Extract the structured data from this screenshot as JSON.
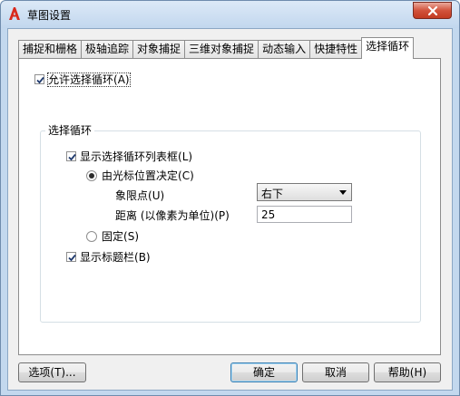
{
  "window": {
    "title": "草图设置"
  },
  "tabs": [
    {
      "label": "捕捉和栅格",
      "active": false
    },
    {
      "label": "极轴追踪",
      "active": false
    },
    {
      "label": "对象捕捉",
      "active": false
    },
    {
      "label": "三维对象捕捉",
      "active": false
    },
    {
      "label": "动态输入",
      "active": false
    },
    {
      "label": "快捷特性",
      "active": false
    },
    {
      "label": "选择循环",
      "active": true
    }
  ],
  "selection_cycling": {
    "allow_label": "允许选择循环",
    "allow_key": "(A)",
    "allow_checked": true,
    "group_title": "选择循环",
    "show_list_label": "显示选择循环列表框",
    "show_list_key": "(L)",
    "show_list_checked": true,
    "cursor_label": "由光标位置决定",
    "cursor_key": "(C)",
    "cursor_selected": true,
    "quadrant_label": "象限点",
    "quadrant_key": "(U)",
    "quadrant_value": "右下",
    "distance_label": "距离 (以像素为单位)",
    "distance_key": "(P)",
    "distance_value": "25",
    "fixed_label": "固定",
    "fixed_key": "(S)",
    "fixed_selected": false,
    "show_title_label": "显示标题栏",
    "show_title_key": "(B)",
    "show_title_checked": true
  },
  "buttons": {
    "options": "选项(T)...",
    "ok": "确定",
    "cancel": "取消",
    "help": "帮助(H)"
  },
  "colors": {
    "accent": "#3c7fb1",
    "close": "#c23a21",
    "app_icon": "#d9291c"
  }
}
